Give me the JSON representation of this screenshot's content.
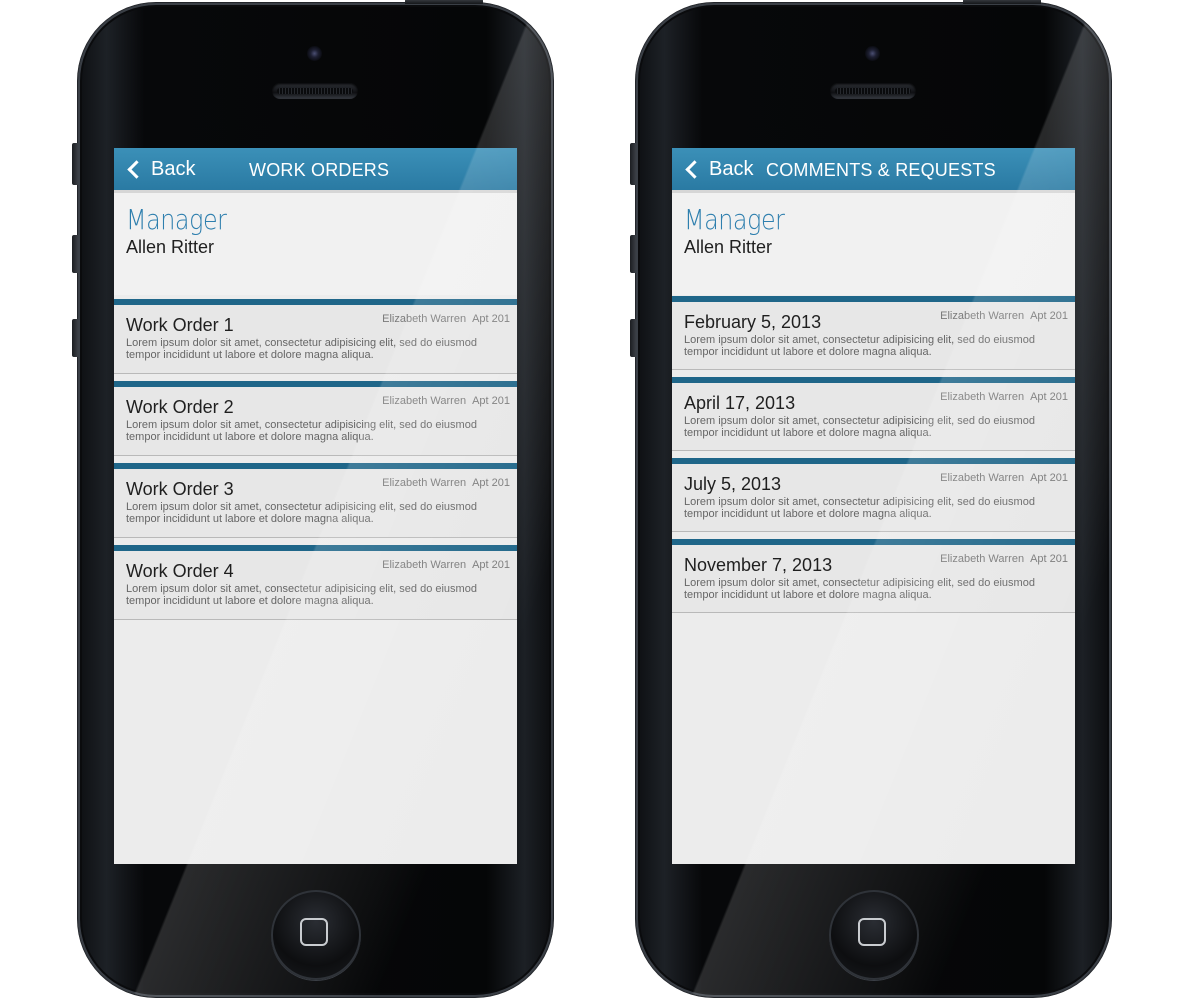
{
  "screens": [
    {
      "back_label": "Back",
      "title": "WORK ORDERS",
      "role": "Manager",
      "person": "Allen Ritter",
      "items": [
        {
          "title": "Work Order 1",
          "name": "Elizabeth Warren",
          "apt": "Apt 201",
          "line1": "Lorem ipsum dolor sit amet, consectetur adipisicing elit, sed do eiusmod",
          "line2": "tempor incididunt ut labore et dolore magna aliqua."
        },
        {
          "title": "Work Order 2",
          "name": "Elizabeth Warren",
          "apt": "Apt 201",
          "line1": "Lorem ipsum dolor sit amet, consectetur adipisicing elit, sed do eiusmod",
          "line2": "tempor incididunt ut labore et dolore magna aliqua."
        },
        {
          "title": "Work Order 3",
          "name": "Elizabeth Warren",
          "apt": "Apt 201",
          "line1": "Lorem ipsum dolor sit amet, consectetur adipisicing elit, sed do eiusmod",
          "line2": "tempor incididunt ut labore et dolore magna aliqua."
        },
        {
          "title": "Work Order 4",
          "name": "Elizabeth Warren",
          "apt": "Apt 201",
          "line1": "Lorem ipsum dolor sit amet, consectetur adipisicing elit, sed do eiusmod",
          "line2": "tempor incididunt ut labore et dolore magna aliqua."
        }
      ]
    },
    {
      "back_label": "Back",
      "title": "COMMENTS & REQUESTS",
      "role": "Manager",
      "person": "Allen Ritter",
      "items": [
        {
          "title": "February 5, 2013",
          "name": "Elizabeth Warren",
          "apt": "Apt 201",
          "line1": "Lorem ipsum dolor sit amet, consectetur adipisicing elit, sed do eiusmod",
          "line2": "tempor incididunt ut labore et dolore magna aliqua."
        },
        {
          "title": "April 17, 2013",
          "name": "Elizabeth Warren",
          "apt": "Apt 201",
          "line1": "Lorem ipsum dolor sit amet, consectetur adipisicing elit, sed do eiusmod",
          "line2": "tempor incididunt ut labore et dolore magna aliqua."
        },
        {
          "title": "July 5, 2013",
          "name": "Elizabeth Warren",
          "apt": "Apt 201",
          "line1": "Lorem ipsum dolor sit amet, consectetur adipisicing elit, sed do eiusmod",
          "line2": "tempor incididunt ut labore et dolore magna aliqua."
        },
        {
          "title": "November 7, 2013",
          "name": "Elizabeth Warren",
          "apt": "Apt 201",
          "line1": "Lorem ipsum dolor sit amet, consectetur adipisicing elit, sed do eiusmod",
          "line2": "tempor incididunt ut labore et dolore magna aliqua."
        }
      ]
    }
  ],
  "colors": {
    "navbar": "#2e82ad",
    "card_accent": "#1f6689",
    "role_text": "#2e7fae",
    "screen_bg": "#ececec"
  }
}
